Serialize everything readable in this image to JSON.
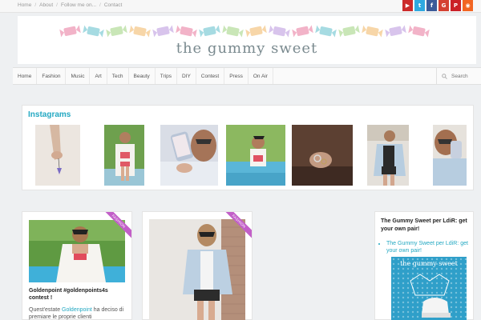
{
  "topbar": {
    "links": [
      "Home",
      "About",
      "Follow me on...",
      "Contact"
    ],
    "social": [
      {
        "icon": "youtube-icon",
        "glyph": "▶",
        "color": "#cc2a2a"
      },
      {
        "icon": "twitter-icon",
        "glyph": "t",
        "color": "#2fa9e0"
      },
      {
        "icon": "facebook-icon",
        "glyph": "f",
        "color": "#3b5b99"
      },
      {
        "icon": "google-plus-icon",
        "glyph": "G",
        "color": "#d44132"
      },
      {
        "icon": "pinterest-icon",
        "glyph": "P",
        "color": "#cb2027"
      },
      {
        "icon": "rss-icon",
        "glyph": "◉",
        "color": "#f26522"
      }
    ]
  },
  "header": {
    "logo_text": "the gummy sweet"
  },
  "nav": {
    "items": [
      "Home",
      "Fashion",
      "Music",
      "Art",
      "Tech",
      "Beauty",
      "Trips",
      "DIY",
      "Contest",
      "Press",
      "On Air"
    ],
    "search_placeholder": "Search"
  },
  "instagram": {
    "title": "Instagrams"
  },
  "posts": [
    {
      "category": "FASHION",
      "title": "Goldenpoint #goldenpoints4s contest !",
      "excerpt_before": "Quest'estate ",
      "excerpt_link": "Goldenpoint",
      "excerpt_after": " ha deciso di premiare le proprie clienti"
    },
    {
      "category": "FASHION"
    }
  ],
  "sidebar": {
    "title": "The Gummy Sweet per LdiR: get your own pair!",
    "link": "The Gummy Sweet per LdiR: get your own pair!",
    "image_text": "the gummy sweet"
  },
  "colors": {
    "accent": "#23a8c2",
    "ribbon": "#c25fc8"
  }
}
